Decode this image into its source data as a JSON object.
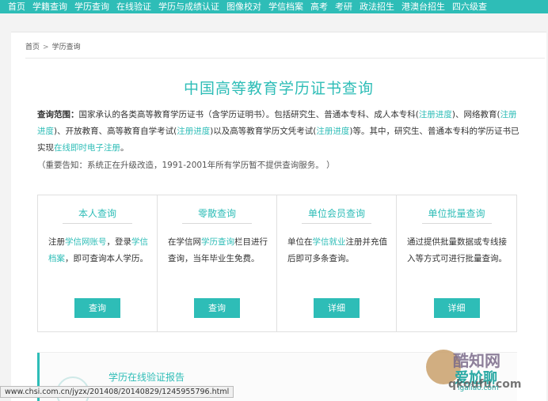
{
  "nav": {
    "items": [
      "首页",
      "学籍查询",
      "学历查询",
      "在线验证",
      "学历与成绩认证",
      "图像校对",
      "学信档案",
      "高考",
      "考研",
      "政法招生",
      "港澳台招生",
      "四六级查"
    ]
  },
  "breadcrumb": {
    "home": "首页",
    "sep": ">",
    "current": "学历查询"
  },
  "page_title": "中国高等教育学历证书查询",
  "description": {
    "label": "查询范围：",
    "text1": "国家承认的各类高等教育学历证书（含学历证明书）。包括研究生、普通本专科、成人本专科(",
    "link1": "注册进度",
    "text2": ")、网络教育(",
    "link2": "注册进度",
    "text3": ")、开放教育、高等教育自学考试(",
    "link3": "注册进度",
    "text4": ")以及高等教育学历文凭考试(",
    "link4": "注册进度",
    "text5": ")等。其中，研究生、普通本专科的学历证书已实现",
    "link5": "在线即时电子注册",
    "text6": "。"
  },
  "notice": "（重要告知：系统正在升级改造，1991-2001年所有学历暂不提供查询服务。 ）",
  "options": [
    {
      "title": "本人查询",
      "t1": "注册",
      "l1": "学信网账号",
      "t2": "，登录",
      "l2": "学信档案",
      "t3": "，即可查询本人学历。",
      "button": "查询"
    },
    {
      "title": "零散查询",
      "t1": "在学信网",
      "l1": "学历查询",
      "t2": "栏目进行查询，当年毕业生免费。",
      "button": "查询"
    },
    {
      "title": "单位会员查询",
      "t1": "单位在",
      "l1": "学信就业",
      "t2": "注册并充值后即可多条查询。",
      "button": "详细"
    },
    {
      "title": "单位批量查询",
      "t1": "通过提供批量数据或专线接入等方式可进行批量查询。",
      "button": "详细"
    }
  ],
  "lower": {
    "title": "学历在线验证报告"
  },
  "status_url": "www.chsi.com.cn/jyzx/201408/20140829/1245955796.html",
  "watermark": {
    "line1": "酷知网",
    "line2": "爱尬聊",
    "line3": "igaliao.com",
    "line4": "qkoufu.com"
  },
  "colors": {
    "accent": "#2ebdb7"
  }
}
